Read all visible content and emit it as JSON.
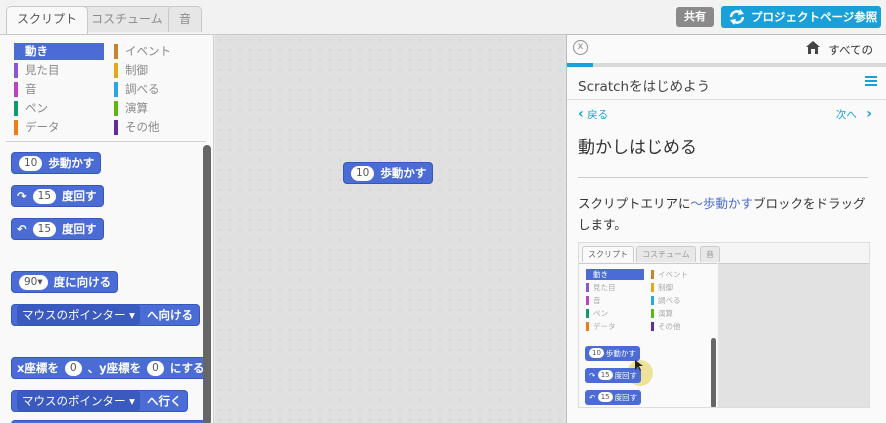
{
  "tabs": [
    {
      "label": "スクリプト",
      "active": true
    },
    {
      "label": "コスチューム",
      "active": false
    },
    {
      "label": "音",
      "active": false
    }
  ],
  "header": {
    "share_label": "共有",
    "project_page_label": "プロジェクトページ参照"
  },
  "categories": [
    {
      "label": "動き",
      "color": "#4a6cd4",
      "selected": true
    },
    {
      "label": "見た目",
      "color": "#8a55d7",
      "selected": false
    },
    {
      "label": "音",
      "color": "#bb42c3",
      "selected": false
    },
    {
      "label": "ペン",
      "color": "#0e9a6c",
      "selected": false
    },
    {
      "label": "データ",
      "color": "#ee7d16",
      "selected": false
    },
    {
      "label": "イベント",
      "color": "#c88330",
      "selected": false
    },
    {
      "label": "制御",
      "color": "#e1a91a",
      "selected": false
    },
    {
      "label": "調べる",
      "color": "#2ca5e2",
      "selected": false
    },
    {
      "label": "演算",
      "color": "#5cb712",
      "selected": false
    },
    {
      "label": "その他",
      "color": "#632d99",
      "selected": false
    }
  ],
  "blocks": {
    "move": {
      "num": "10",
      "text": "歩動かす"
    },
    "turn_right": {
      "num": "15",
      "text": "度回す"
    },
    "turn_left": {
      "num": "15",
      "text": "度回す"
    },
    "point_dir": {
      "num": "90▾",
      "text": "度に向ける"
    },
    "point_towards": {
      "dropdown": "マウスのポインター ▾",
      "text": "へ向ける"
    },
    "goto_xy": {
      "prefix": "x座標を",
      "x": "0",
      "mid": "、y座標を",
      "y": "0",
      "suffix": "にする"
    },
    "goto": {
      "dropdown": "マウスのポインター ▾",
      "text": "へ行く"
    }
  },
  "script_block": {
    "num": "10",
    "text": "歩動かす"
  },
  "tips": {
    "close_label": "x",
    "all_label": "すべての",
    "title": "Scratchをはじめよう",
    "back_label": "戻る",
    "next_label": "次へ",
    "step_title": "動かしはじめる",
    "text_before": "スクリプトエリアに",
    "text_highlight": "〜歩動かす",
    "text_after": "ブロックをドラッグします。",
    "progress": 0.08
  },
  "mini": {
    "tabs": [
      "スクリプト",
      "コスチューム",
      "音"
    ],
    "blocks": [
      {
        "num": "10",
        "text": "歩動かす"
      },
      {
        "num": "15",
        "text": "度回す"
      },
      {
        "num": "15",
        "text": "度回す"
      }
    ]
  },
  "colors": {
    "accent": "#1aa0d8",
    "motion": "#4a6cd4"
  }
}
